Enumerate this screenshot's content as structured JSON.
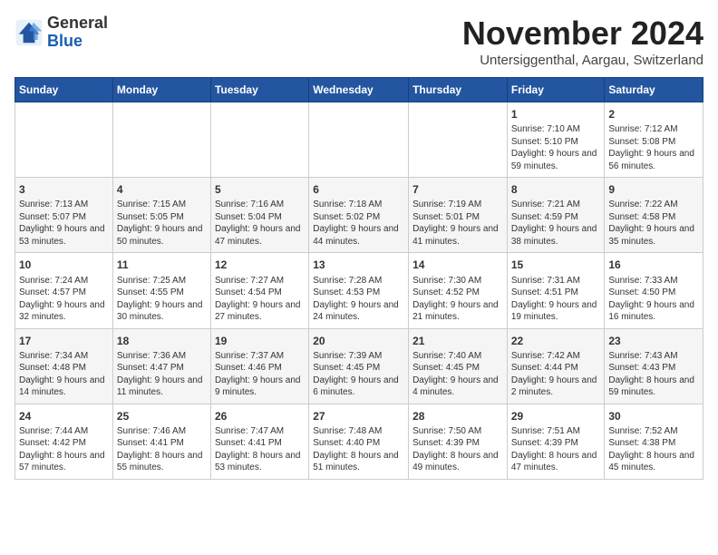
{
  "header": {
    "logo_line1": "General",
    "logo_line2": "Blue",
    "month_title": "November 2024",
    "subtitle": "Untersiggenthal, Aargau, Switzerland"
  },
  "calendar": {
    "days_of_week": [
      "Sunday",
      "Monday",
      "Tuesday",
      "Wednesday",
      "Thursday",
      "Friday",
      "Saturday"
    ],
    "weeks": [
      {
        "days": [
          {
            "number": "",
            "info": ""
          },
          {
            "number": "",
            "info": ""
          },
          {
            "number": "",
            "info": ""
          },
          {
            "number": "",
            "info": ""
          },
          {
            "number": "",
            "info": ""
          },
          {
            "number": "1",
            "info": "Sunrise: 7:10 AM\nSunset: 5:10 PM\nDaylight: 9 hours and 59 minutes."
          },
          {
            "number": "2",
            "info": "Sunrise: 7:12 AM\nSunset: 5:08 PM\nDaylight: 9 hours and 56 minutes."
          }
        ]
      },
      {
        "days": [
          {
            "number": "3",
            "info": "Sunrise: 7:13 AM\nSunset: 5:07 PM\nDaylight: 9 hours and 53 minutes."
          },
          {
            "number": "4",
            "info": "Sunrise: 7:15 AM\nSunset: 5:05 PM\nDaylight: 9 hours and 50 minutes."
          },
          {
            "number": "5",
            "info": "Sunrise: 7:16 AM\nSunset: 5:04 PM\nDaylight: 9 hours and 47 minutes."
          },
          {
            "number": "6",
            "info": "Sunrise: 7:18 AM\nSunset: 5:02 PM\nDaylight: 9 hours and 44 minutes."
          },
          {
            "number": "7",
            "info": "Sunrise: 7:19 AM\nSunset: 5:01 PM\nDaylight: 9 hours and 41 minutes."
          },
          {
            "number": "8",
            "info": "Sunrise: 7:21 AM\nSunset: 4:59 PM\nDaylight: 9 hours and 38 minutes."
          },
          {
            "number": "9",
            "info": "Sunrise: 7:22 AM\nSunset: 4:58 PM\nDaylight: 9 hours and 35 minutes."
          }
        ]
      },
      {
        "days": [
          {
            "number": "10",
            "info": "Sunrise: 7:24 AM\nSunset: 4:57 PM\nDaylight: 9 hours and 32 minutes."
          },
          {
            "number": "11",
            "info": "Sunrise: 7:25 AM\nSunset: 4:55 PM\nDaylight: 9 hours and 30 minutes."
          },
          {
            "number": "12",
            "info": "Sunrise: 7:27 AM\nSunset: 4:54 PM\nDaylight: 9 hours and 27 minutes."
          },
          {
            "number": "13",
            "info": "Sunrise: 7:28 AM\nSunset: 4:53 PM\nDaylight: 9 hours and 24 minutes."
          },
          {
            "number": "14",
            "info": "Sunrise: 7:30 AM\nSunset: 4:52 PM\nDaylight: 9 hours and 21 minutes."
          },
          {
            "number": "15",
            "info": "Sunrise: 7:31 AM\nSunset: 4:51 PM\nDaylight: 9 hours and 19 minutes."
          },
          {
            "number": "16",
            "info": "Sunrise: 7:33 AM\nSunset: 4:50 PM\nDaylight: 9 hours and 16 minutes."
          }
        ]
      },
      {
        "days": [
          {
            "number": "17",
            "info": "Sunrise: 7:34 AM\nSunset: 4:48 PM\nDaylight: 9 hours and 14 minutes."
          },
          {
            "number": "18",
            "info": "Sunrise: 7:36 AM\nSunset: 4:47 PM\nDaylight: 9 hours and 11 minutes."
          },
          {
            "number": "19",
            "info": "Sunrise: 7:37 AM\nSunset: 4:46 PM\nDaylight: 9 hours and 9 minutes."
          },
          {
            "number": "20",
            "info": "Sunrise: 7:39 AM\nSunset: 4:45 PM\nDaylight: 9 hours and 6 minutes."
          },
          {
            "number": "21",
            "info": "Sunrise: 7:40 AM\nSunset: 4:45 PM\nDaylight: 9 hours and 4 minutes."
          },
          {
            "number": "22",
            "info": "Sunrise: 7:42 AM\nSunset: 4:44 PM\nDaylight: 9 hours and 2 minutes."
          },
          {
            "number": "23",
            "info": "Sunrise: 7:43 AM\nSunset: 4:43 PM\nDaylight: 8 hours and 59 minutes."
          }
        ]
      },
      {
        "days": [
          {
            "number": "24",
            "info": "Sunrise: 7:44 AM\nSunset: 4:42 PM\nDaylight: 8 hours and 57 minutes."
          },
          {
            "number": "25",
            "info": "Sunrise: 7:46 AM\nSunset: 4:41 PM\nDaylight: 8 hours and 55 minutes."
          },
          {
            "number": "26",
            "info": "Sunrise: 7:47 AM\nSunset: 4:41 PM\nDaylight: 8 hours and 53 minutes."
          },
          {
            "number": "27",
            "info": "Sunrise: 7:48 AM\nSunset: 4:40 PM\nDaylight: 8 hours and 51 minutes."
          },
          {
            "number": "28",
            "info": "Sunrise: 7:50 AM\nSunset: 4:39 PM\nDaylight: 8 hours and 49 minutes."
          },
          {
            "number": "29",
            "info": "Sunrise: 7:51 AM\nSunset: 4:39 PM\nDaylight: 8 hours and 47 minutes."
          },
          {
            "number": "30",
            "info": "Sunrise: 7:52 AM\nSunset: 4:38 PM\nDaylight: 8 hours and 45 minutes."
          }
        ]
      }
    ]
  }
}
